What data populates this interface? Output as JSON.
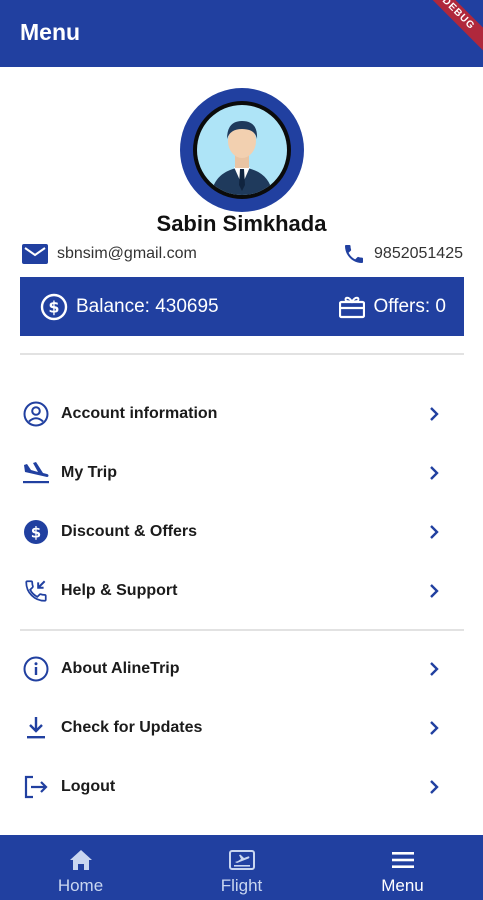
{
  "app_bar": {
    "title": "Menu",
    "debug_badge": "DEBUG"
  },
  "profile": {
    "name": "Sabin Simkhada",
    "email": "sbnsim@gmail.com",
    "phone": "9852051425"
  },
  "summary": {
    "balance": "Balance: 430695",
    "offers": "Offers: 0"
  },
  "menu_group_1": [
    {
      "label": "Account information",
      "icon": "account-circle-icon"
    },
    {
      "label": "My Trip",
      "icon": "flight-land-icon"
    },
    {
      "label": "Discount & Offers",
      "icon": "dollar-circle-icon"
    },
    {
      "label": "Help & Support",
      "icon": "phone-callback-icon"
    }
  ],
  "menu_group_2": [
    {
      "label": "About AlineTrip",
      "icon": "info-icon"
    },
    {
      "label": "Check for Updates",
      "icon": "download-icon"
    },
    {
      "label": "Logout",
      "icon": "logout-icon"
    }
  ],
  "bottom_nav": [
    {
      "label": "Home",
      "icon": "home-icon"
    },
    {
      "label": "Flight",
      "icon": "flight-ticket-icon"
    },
    {
      "label": "Menu",
      "icon": "menu-icon",
      "active": true
    }
  ],
  "colors": {
    "primary": "#2140a0",
    "avatar_bg": "#aee4f7",
    "text": "#1b1b1b"
  }
}
